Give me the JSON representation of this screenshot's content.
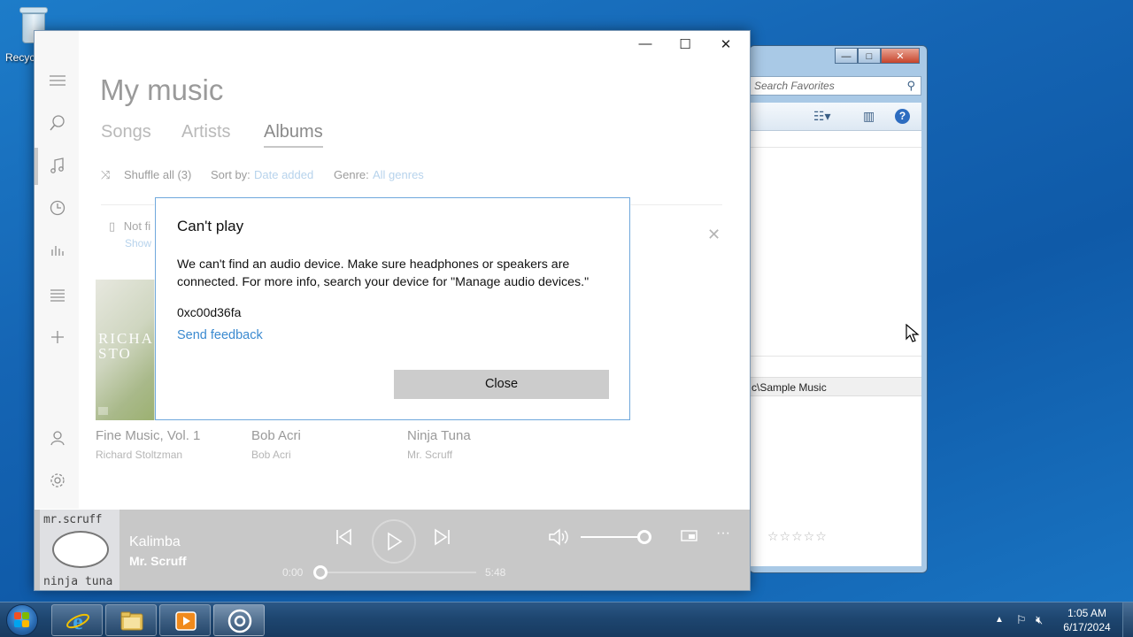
{
  "desktop": {
    "recycle_bin_label": "Recyc"
  },
  "explorer": {
    "search_placeholder": "Search Favorites",
    "path_text": "c\\Sample Music",
    "rating_stars": "☆☆☆☆☆"
  },
  "groove": {
    "title": "My music",
    "tabs": [
      "Songs",
      "Artists",
      "Albums"
    ],
    "active_tab": "Albums",
    "shuffle_label": "Shuffle all (3)",
    "sort_label": "Sort by:",
    "sort_value": "Date added",
    "genre_label": "Genre:",
    "genre_value": "All genres",
    "notification_text": "Not fi",
    "notification_link": "Show",
    "album_art_text": "RICHA STO",
    "albums": [
      {
        "title": "Fine Music, Vol. 1",
        "artist": "Richard Stoltzman"
      },
      {
        "title": "Bob Acri",
        "artist": "Bob Acri"
      },
      {
        "title": "Ninja Tuna",
        "artist": "Mr. Scruff"
      }
    ],
    "player": {
      "art_top_text": "mr.scruff",
      "art_bottom_text": "ninja tuna",
      "track": "Kalimba",
      "artist": "Mr. Scruff",
      "elapsed": "0:00",
      "duration": "5:48",
      "progress_fraction": 0.0,
      "volume_fraction": 1.0
    }
  },
  "dialog": {
    "title": "Can't play",
    "message": "We can't find an audio device. Make sure headphones or speakers are connected. For more info, search your device for \"Manage audio devices.\"",
    "error_code": "0xc00d36fa",
    "link": "Send feedback",
    "close_button": "Close"
  },
  "taskbar": {
    "time": "1:05 AM",
    "date": "6/17/2024",
    "icons": [
      "internet-explorer-icon",
      "file-explorer-icon",
      "media-player-icon",
      "groove-music-icon"
    ]
  },
  "colors": {
    "dialog_border": "#6fa8dc",
    "link_blue": "#3b8ad0",
    "close_button_bg": "#cccccc",
    "player_bar": "#c8c8c8"
  }
}
